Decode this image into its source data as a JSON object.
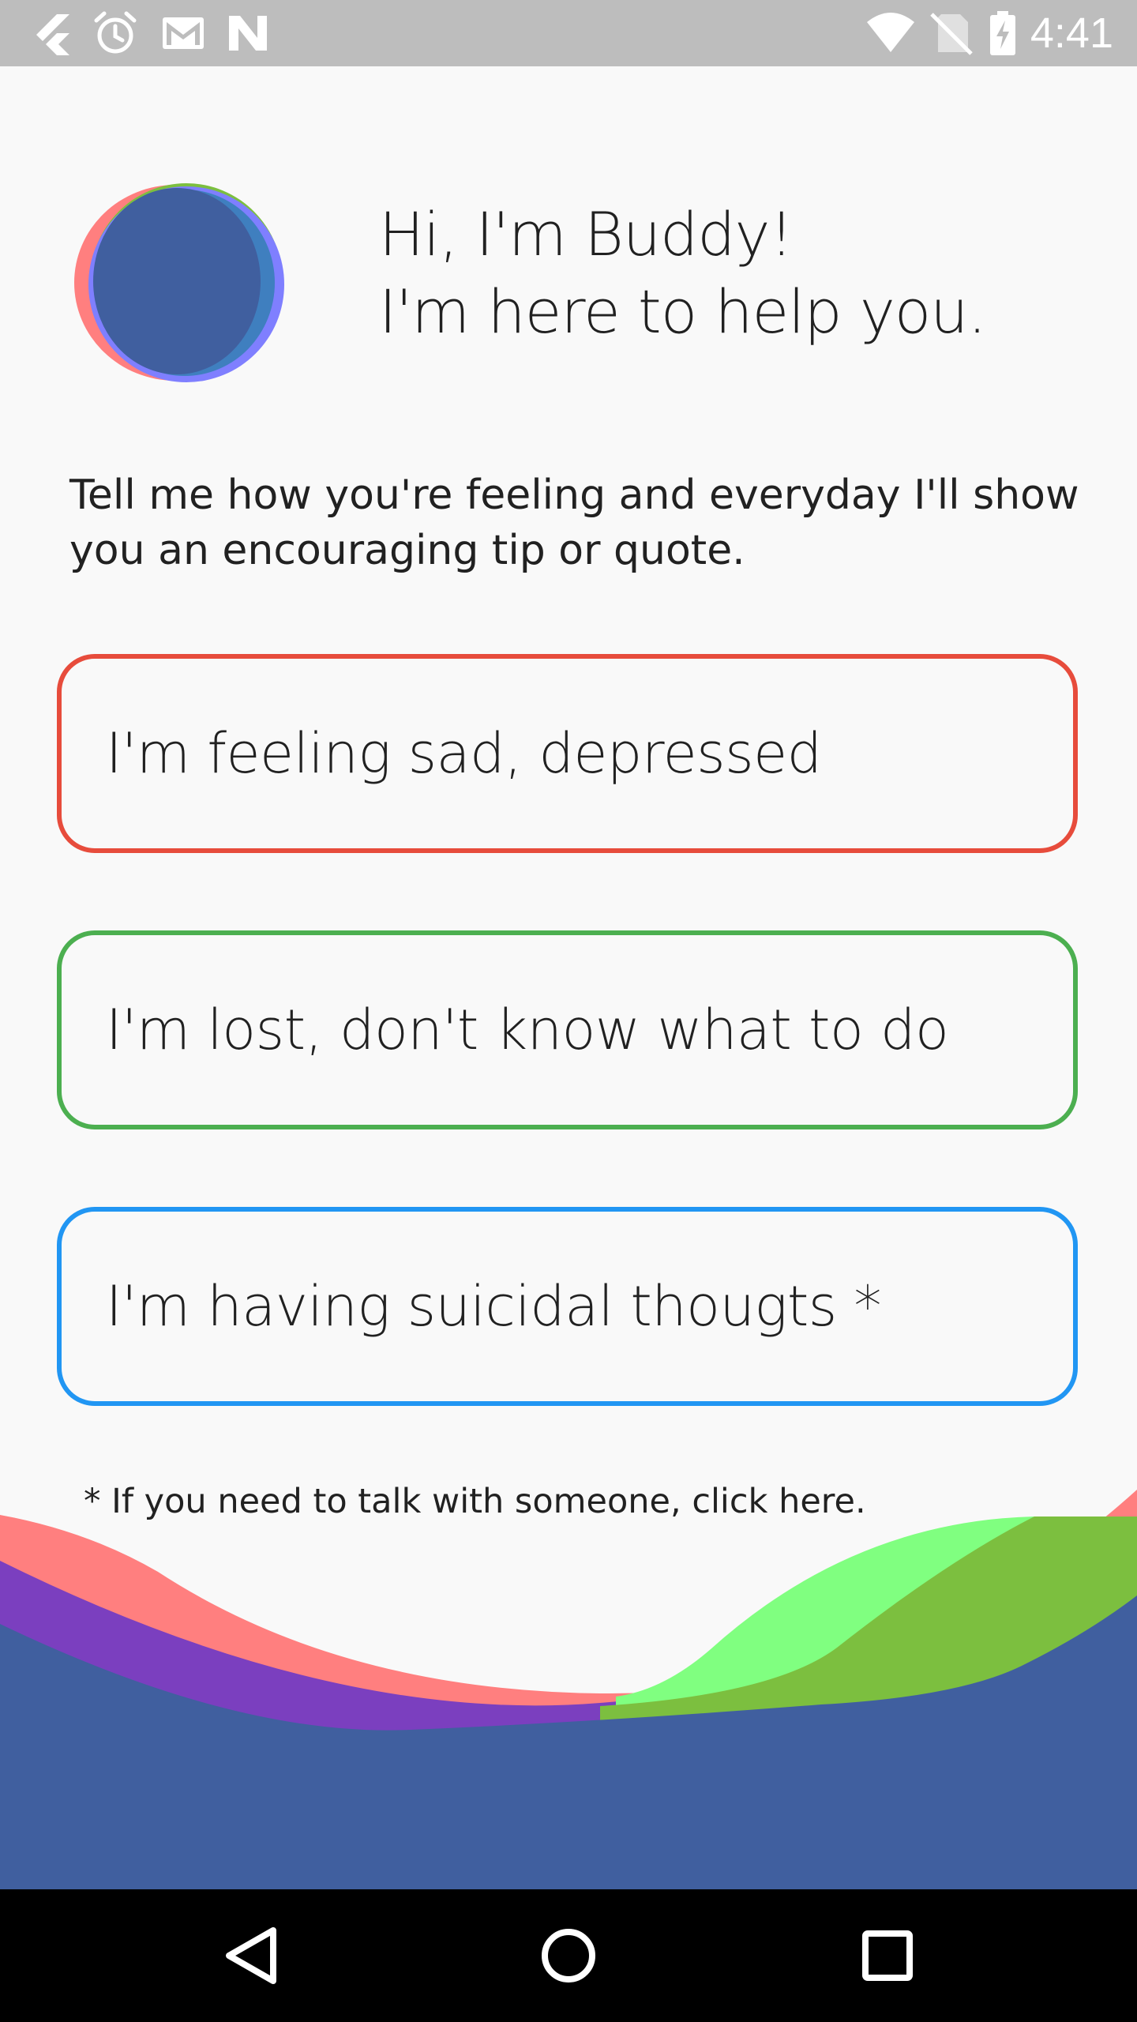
{
  "status_bar": {
    "time": "4:41",
    "left_icons": [
      "flutter-icon",
      "alarm-icon",
      "gmail-icon",
      "n-icon"
    ],
    "right_icons": [
      "wifi-icon",
      "no-sim-icon",
      "battery-charging-icon"
    ]
  },
  "header": {
    "greeting_line1": "Hi, I'm Buddy!",
    "greeting_line2": "I'm here to help you."
  },
  "intro": "Tell me how you're feeling and everyday I'll show you an encouraging tip or quote.",
  "options": [
    {
      "label": "I'm feeling sad, depressed",
      "color": "#e74c3c"
    },
    {
      "label": "I'm lost, don't know what to do",
      "color": "#4caf50"
    },
    {
      "label": "I'm having suicidal thougts *",
      "color": "#2196f3"
    }
  ],
  "footnote": "* If you need to talk with someone, click here.",
  "colors": {
    "wave_pink": "#ff7f7f",
    "wave_purple": "#7b3fbf",
    "wave_green": "#80ff80",
    "wave_olive": "#7cbf3f",
    "wave_blue": "#405f9f"
  },
  "nav": {
    "icons": [
      "back-icon",
      "home-icon",
      "recents-icon"
    ]
  }
}
